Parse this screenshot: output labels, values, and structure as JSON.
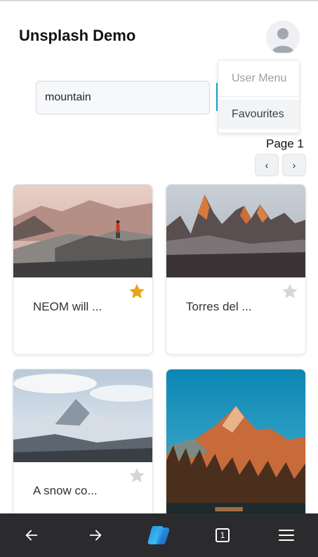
{
  "app": {
    "title": "Unsplash Demo"
  },
  "user_menu": {
    "header": "User Menu",
    "items": [
      {
        "label": "Favourites"
      }
    ]
  },
  "search": {
    "value": "mountain"
  },
  "pagination": {
    "page_label": "Page 1",
    "prev": "‹",
    "next": "›"
  },
  "cards": [
    {
      "caption": "NEOM will ...",
      "favourite": true
    },
    {
      "caption": "Torres del ...",
      "favourite": false
    },
    {
      "caption": "A snow co...",
      "favourite": false
    },
    {
      "caption": "",
      "favourite": false
    }
  ],
  "browser_bar": {
    "tab_count": "1"
  },
  "icons": {
    "avatar": "person-icon",
    "star": "star-icon",
    "back": "arrow-left-icon",
    "forward": "arrow-right-icon",
    "copilot": "copilot-icon",
    "tabs": "tabs-icon",
    "menu": "hamburger-menu-icon"
  },
  "colors": {
    "star_active": "#e8a317",
    "star_inactive": "#d4d6da",
    "accent": "#1aa0c8",
    "bottom_bar": "#2b2b2e"
  }
}
